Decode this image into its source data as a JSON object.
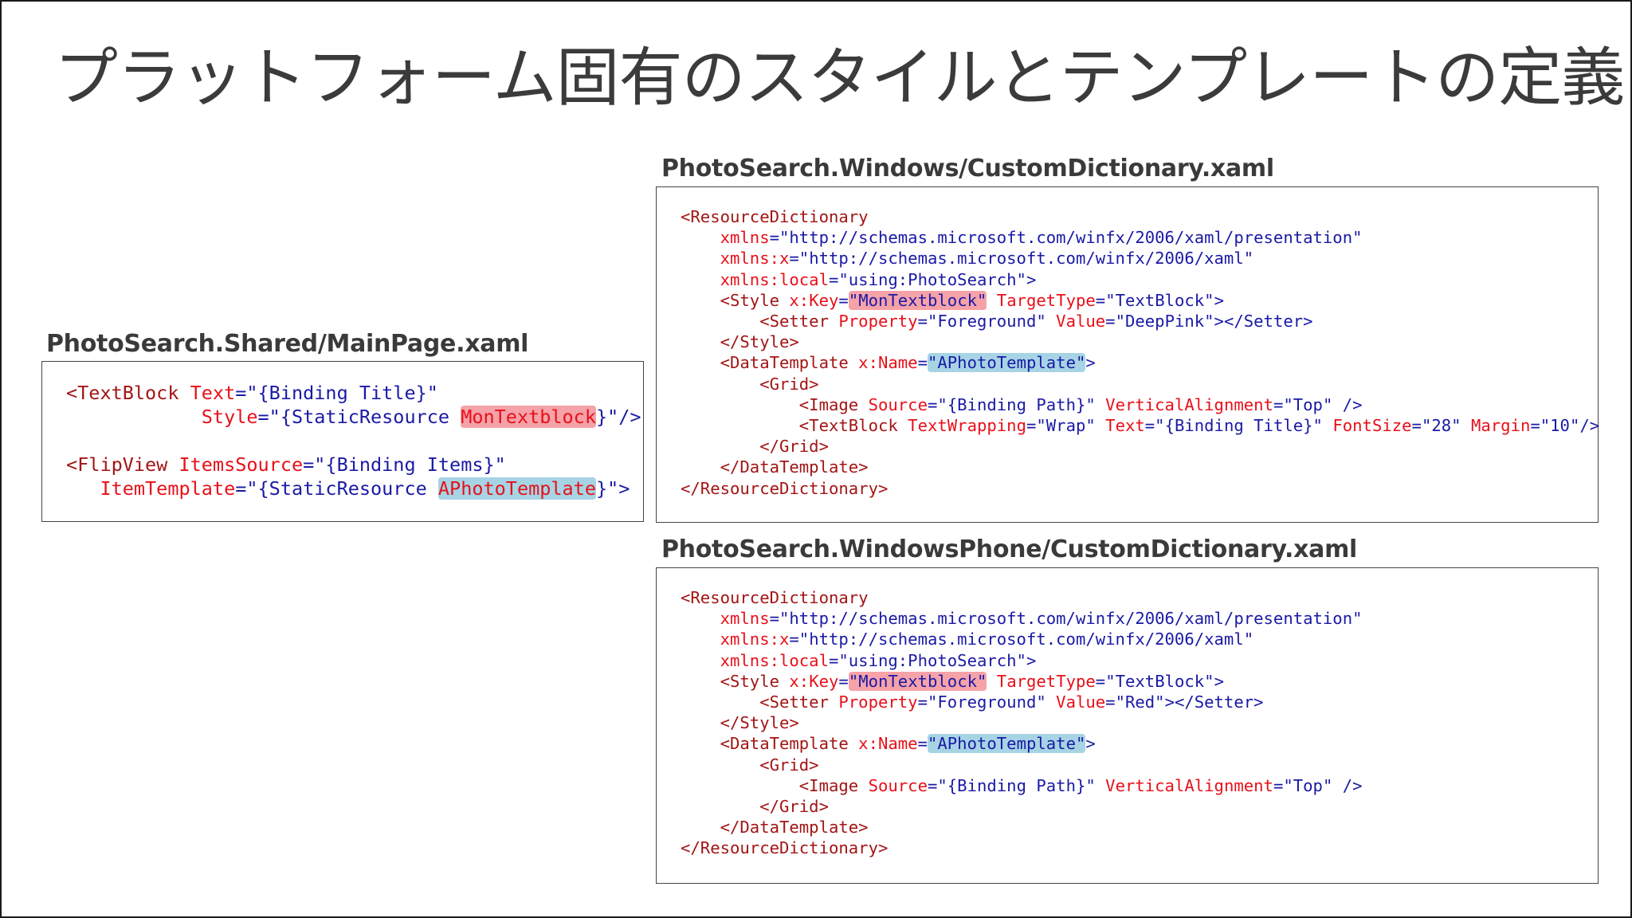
{
  "slide": {
    "title": "プラットフォーム固有のスタイルとテンプレートの定義"
  },
  "shared": {
    "caption": "PhotoSearch.Shared/MainPage.xaml",
    "lines": [
      [
        {
          "text": "<TextBlock",
          "c": "t"
        },
        {
          "text": " Text",
          "c": "a"
        },
        {
          "text": "=\"{Binding Title}\"",
          "c": "b"
        }
      ],
      [
        {
          "text": "            Style",
          "c": "a"
        },
        {
          "text": "=\"{StaticResource ",
          "c": "b"
        },
        {
          "text": "MonTextblock",
          "c": "a",
          "hl": "red"
        },
        {
          "text": "}\"/>",
          "c": "b"
        }
      ],
      [],
      [
        {
          "text": "<FlipView",
          "c": "t"
        },
        {
          "text": " ItemsSource",
          "c": "a"
        },
        {
          "text": "=\"{Binding Items}\"",
          "c": "b"
        }
      ],
      [
        {
          "text": "   ItemTemplate",
          "c": "a"
        },
        {
          "text": "=\"{StaticResource ",
          "c": "b"
        },
        {
          "text": "APhotoTemplate",
          "c": "a",
          "hl": "blue"
        },
        {
          "text": "}\">",
          "c": "b"
        }
      ]
    ]
  },
  "windows": {
    "caption": "PhotoSearch.Windows/CustomDictionary.xaml",
    "lines": [
      [
        {
          "text": "<ResourceDictionary",
          "c": "t"
        }
      ],
      [
        {
          "text": "    xmlns",
          "c": "a"
        },
        {
          "text": "=\"http://schemas.microsoft.com/winfx/2006/xaml/presentation\"",
          "c": "b"
        }
      ],
      [
        {
          "text": "    xmlns:x",
          "c": "a"
        },
        {
          "text": "=\"http://schemas.microsoft.com/winfx/2006/xaml\"",
          "c": "b"
        }
      ],
      [
        {
          "text": "    xmlns:local",
          "c": "a"
        },
        {
          "text": "=\"using:PhotoSearch\">",
          "c": "b"
        }
      ],
      [
        {
          "text": "    <Style",
          "c": "t"
        },
        {
          "text": " x:Key",
          "c": "a"
        },
        {
          "text": "=",
          "c": "b"
        },
        {
          "text": "\"MonTextblock\"",
          "c": "b",
          "hl": "red"
        },
        {
          "text": " TargetType",
          "c": "a"
        },
        {
          "text": "=\"TextBlock\">",
          "c": "b"
        }
      ],
      [
        {
          "text": "        <Setter",
          "c": "t"
        },
        {
          "text": " Property",
          "c": "a"
        },
        {
          "text": "=\"Foreground\"",
          "c": "b"
        },
        {
          "text": " Value",
          "c": "a"
        },
        {
          "text": "=\"DeepPink\"></Setter>",
          "c": "b"
        }
      ],
      [
        {
          "text": "    </Style>",
          "c": "t"
        }
      ],
      [
        {
          "text": "    <DataTemplate",
          "c": "t"
        },
        {
          "text": " x:Name",
          "c": "a"
        },
        {
          "text": "=",
          "c": "b"
        },
        {
          "text": "\"APhotoTemplate\"",
          "c": "b",
          "hl": "blue"
        },
        {
          "text": ">",
          "c": "b"
        }
      ],
      [
        {
          "text": "        <Grid>",
          "c": "t"
        }
      ],
      [
        {
          "text": "            <Image",
          "c": "t"
        },
        {
          "text": " Source",
          "c": "a"
        },
        {
          "text": "=\"{Binding Path}\"",
          "c": "b"
        },
        {
          "text": " VerticalAlignment",
          "c": "a"
        },
        {
          "text": "=\"Top\" />",
          "c": "b"
        }
      ],
      [
        {
          "text": "            <TextBlock",
          "c": "t"
        },
        {
          "text": " TextWrapping",
          "c": "a"
        },
        {
          "text": "=\"Wrap\"",
          "c": "b"
        },
        {
          "text": " Text",
          "c": "a"
        },
        {
          "text": "=\"{Binding Title}\"",
          "c": "b"
        },
        {
          "text": " FontSize",
          "c": "a"
        },
        {
          "text": "=\"28\"",
          "c": "b"
        },
        {
          "text": " Margin",
          "c": "a"
        },
        {
          "text": "=\"10\"/>",
          "c": "b"
        }
      ],
      [
        {
          "text": "        </Grid>",
          "c": "t"
        }
      ],
      [
        {
          "text": "    </DataTemplate>",
          "c": "t"
        }
      ],
      [
        {
          "text": "</ResourceDictionary>",
          "c": "t"
        }
      ]
    ]
  },
  "phone": {
    "caption": "PhotoSearch.WindowsPhone/CustomDictionary.xaml",
    "lines": [
      [
        {
          "text": "<ResourceDictionary",
          "c": "t"
        }
      ],
      [
        {
          "text": "    xmlns",
          "c": "a"
        },
        {
          "text": "=\"http://schemas.microsoft.com/winfx/2006/xaml/presentation\"",
          "c": "b"
        }
      ],
      [
        {
          "text": "    xmlns:x",
          "c": "a"
        },
        {
          "text": "=\"http://schemas.microsoft.com/winfx/2006/xaml\"",
          "c": "b"
        }
      ],
      [
        {
          "text": "    xmlns:local",
          "c": "a"
        },
        {
          "text": "=\"using:PhotoSearch\">",
          "c": "b"
        }
      ],
      [
        {
          "text": "    <Style",
          "c": "t"
        },
        {
          "text": " x:Key",
          "c": "a"
        },
        {
          "text": "=",
          "c": "b"
        },
        {
          "text": "\"MonTextblock\"",
          "c": "b",
          "hl": "red"
        },
        {
          "text": " TargetType",
          "c": "a"
        },
        {
          "text": "=\"TextBlock\">",
          "c": "b"
        }
      ],
      [
        {
          "text": "        <Setter",
          "c": "t"
        },
        {
          "text": " Property",
          "c": "a"
        },
        {
          "text": "=\"Foreground\"",
          "c": "b"
        },
        {
          "text": " Value",
          "c": "a"
        },
        {
          "text": "=\"Red\"></Setter>",
          "c": "b"
        }
      ],
      [
        {
          "text": "    </Style>",
          "c": "t"
        }
      ],
      [
        {
          "text": "    <DataTemplate",
          "c": "t"
        },
        {
          "text": " x:Name",
          "c": "a"
        },
        {
          "text": "=",
          "c": "b"
        },
        {
          "text": "\"APhotoTemplate\"",
          "c": "b",
          "hl": "blue"
        },
        {
          "text": ">",
          "c": "b"
        }
      ],
      [
        {
          "text": "        <Grid>",
          "c": "t"
        }
      ],
      [
        {
          "text": "            <Image",
          "c": "t"
        },
        {
          "text": " Source",
          "c": "a"
        },
        {
          "text": "=\"{Binding Path}\"",
          "c": "b"
        },
        {
          "text": " VerticalAlignment",
          "c": "a"
        },
        {
          "text": "=\"Top\" />",
          "c": "b"
        }
      ],
      [
        {
          "text": "        </Grid>",
          "c": "t"
        }
      ],
      [
        {
          "text": "    </DataTemplate>",
          "c": "t"
        }
      ],
      [
        {
          "text": "</ResourceDictionary>",
          "c": "t"
        }
      ]
    ]
  },
  "colors": {
    "tag": "#a31515",
    "attribute": "#e8101a",
    "value": "#1a1aa6",
    "highlight_red": "#f5a2a8",
    "highlight_blue": "#a6d4e4"
  }
}
